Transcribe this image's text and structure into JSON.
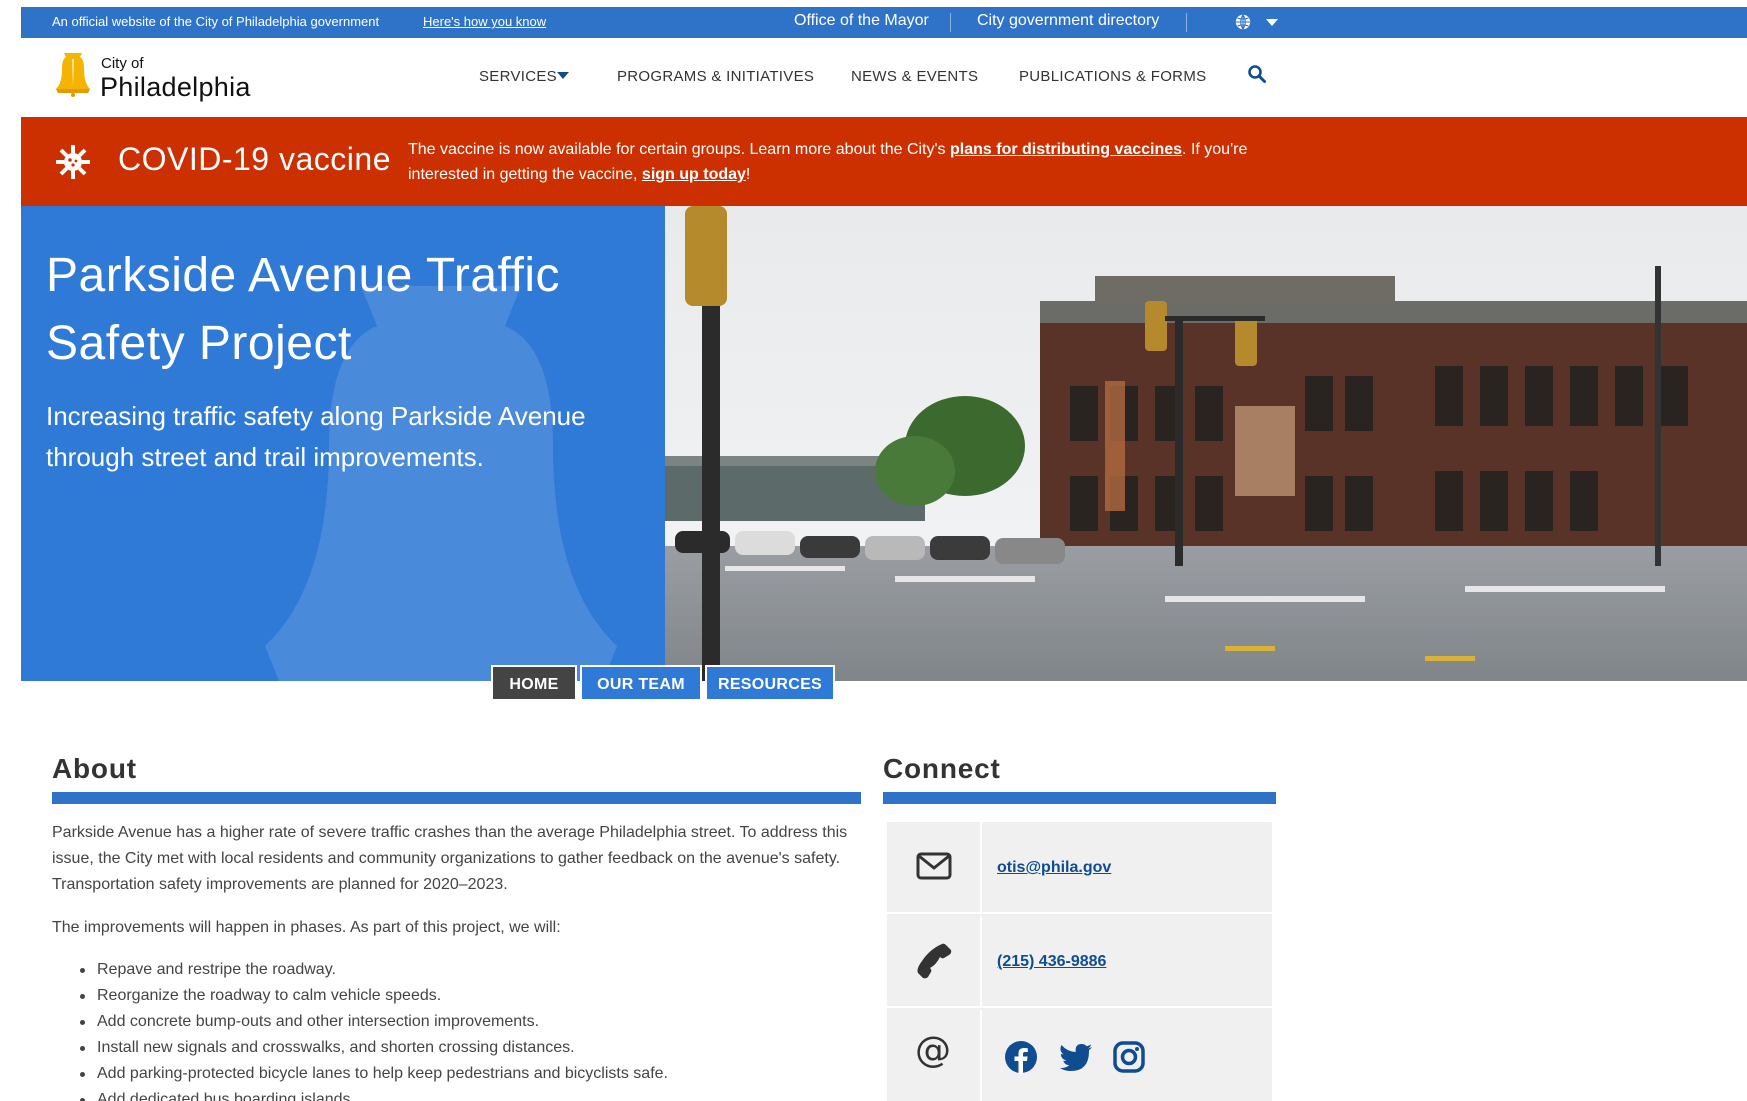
{
  "topbar": {
    "official_text": "An official website of the City of Philadelphia government",
    "how_link": "Here's how you know",
    "mayor_link": "Office of the Mayor",
    "directory_link": "City government directory",
    "globe_icon": "globe-icon"
  },
  "header": {
    "logo_city_of": "City of",
    "logo_name": "Philadelphia",
    "nav": {
      "services": "SERVICES",
      "programs": "PROGRAMS & INITIATIVES",
      "news": "NEWS & EVENTS",
      "publications": "PUBLICATIONS & FORMS"
    },
    "search_icon": "search-icon"
  },
  "alert": {
    "title": "COVID-19 vaccine",
    "text_before": "The vaccine is now available for certain groups. Learn more about the City's ",
    "link1": "plans for distributing vaccines",
    "text_middle": ". If you're interested in getting the vaccine, ",
    "link2": "sign up today",
    "text_after": "!",
    "color": "#cc3000"
  },
  "hero": {
    "title": "Parkside Avenue Traffic Safety Project",
    "subtitle": "Increasing traffic safety along Parkside Avenue through street and trail improvements.",
    "panel_color": "#2f7ad6"
  },
  "tabs": {
    "home": "HOME",
    "team": "OUR TEAM",
    "resources": "RESOURCES"
  },
  "about": {
    "title": "About",
    "p1": "Parkside Avenue has a higher rate of severe traffic crashes than the average Philadelphia street. To address this issue, the City met with local residents and community organizations to gather feedback on the avenue's safety. Transportation safety improvements are planned for 2020–2023.",
    "p2": "The improvements will happen in phases. As part of this project, we will:",
    "items": [
      "Repave and restripe the roadway.",
      "Reorganize the roadway to calm vehicle speeds.",
      "Add concrete bump-outs and other intersection improvements.",
      "Install new signals and crosswalks, and shorten crossing distances.",
      "Add parking-protected bicycle lanes to help keep pedestrians and bicyclists safe.",
      "Add dedicated bus boarding islands."
    ]
  },
  "connect": {
    "title": "Connect",
    "email": "otis@phila.gov",
    "phone": "(215) 436-9886",
    "at_symbol": "@",
    "icons": [
      "envelope-icon",
      "phone-icon",
      "facebook-icon",
      "twitter-icon",
      "instagram-icon"
    ]
  }
}
